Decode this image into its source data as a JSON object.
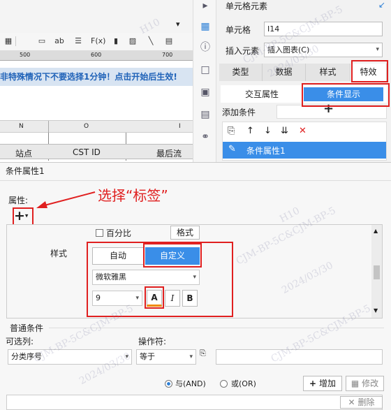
{
  "sheet": {
    "ruler_marks": [
      "500",
      "600",
      "700"
    ],
    "notice_text": "非特殊情况下不要选择1分钟！点击开始后生效!",
    "col_letters": [
      "N",
      "O",
      "I"
    ],
    "table_headers": [
      "站点",
      "CST ID",
      "最后流"
    ]
  },
  "right_panel": {
    "title": "单元格元素",
    "cell_label": "单元格",
    "cell_value": "I14",
    "insert_label": "插入元素",
    "insert_value": "插入图表(C)",
    "tabs": [
      "类型",
      "数据",
      "样式",
      "特效"
    ],
    "subtabs": [
      "交互属性",
      "条件显示"
    ],
    "add_condition_label": "添加条件",
    "add_symbol": "+",
    "condition_item": "条件属性1"
  },
  "dialog": {
    "title": "条件属性1",
    "attr_label": "属性:",
    "annotation": "选择“标签”",
    "percent_label": "百分比",
    "format_label": "格式",
    "style_label": "样式",
    "auto_label": "自动",
    "custom_label": "自定义",
    "font_name": "微软雅黑",
    "font_size": "9",
    "bold_label": "B",
    "italic_label": "I",
    "color_label": "A",
    "normal_cond_label": "普通条件",
    "col_label": "可选列:",
    "op_label": "操作符:",
    "col_value": "分类序号",
    "op_value": "等于",
    "and_label": "与(AND)",
    "or_label": "或(OR)",
    "add_label": "增加",
    "modify_label": "修改",
    "delete_label": "删除"
  },
  "watermarks": [
    "H10",
    "CJM-BP-5C&CJM-BP-5",
    "2024/03/30"
  ],
  "colors": {
    "accent": "#3a8ee8",
    "annotation_red": "#e02020",
    "notice_text": "#1f62b8"
  }
}
